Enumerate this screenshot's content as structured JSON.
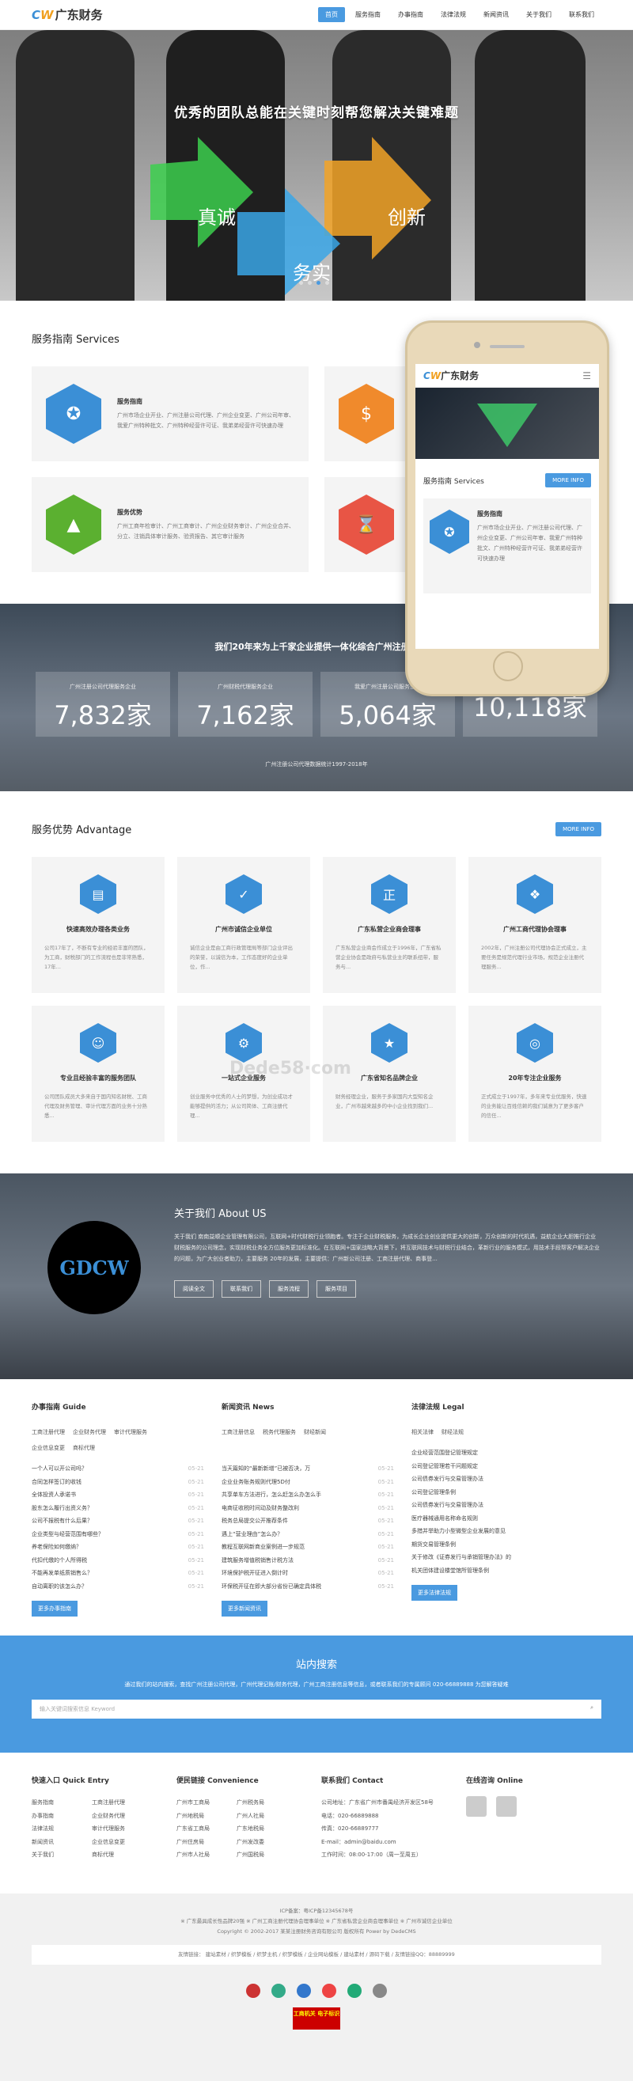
{
  "header": {
    "logo_mark1": "C",
    "logo_mark2": "W",
    "logo_text": "广东财务",
    "nav": [
      "首页",
      "服务指南",
      "办事指南",
      "法律法规",
      "新闻资讯",
      "关于我们",
      "联系我们"
    ]
  },
  "banner": {
    "slogan": "优秀的团队总能在关键时刻帮您解决关键难题",
    "arrow_words": [
      "真诚",
      "创新",
      "务实"
    ]
  },
  "services": {
    "title": "服务指南 Services",
    "items": [
      {
        "title": "服务指南",
        "desc": "广州市场企业开业、广州注册公司代理、广州企业变更、广州公司年审、我爱广州特种批文、广州特种经营许可证、我弟弟经营许可快速办理",
        "icon": "award-icon",
        "color": "#3b8fd6"
      },
      {
        "title": "",
        "desc": "",
        "icon": "money-bag-icon",
        "color": "#f08a2c"
      },
      {
        "title": "服务优势",
        "desc": "广州工商年检审计、广州工商审计、广州企业财务审计、广州企业合并、分立、注销具体审计服务、验资报告、其它审计服务",
        "icon": "chart-icon",
        "color": "#5bb030"
      },
      {
        "title": "",
        "desc": "",
        "icon": "hourglass-icon",
        "color": "#e85545"
      }
    ]
  },
  "stats": {
    "heading": "我们20年来为上千家企业提供一体化综合广州注册公",
    "items": [
      {
        "label": "广州注册公司代理服务企业",
        "value": "7,832家"
      },
      {
        "label": "广州财税代理服务企业",
        "value": "7,162家"
      },
      {
        "label": "我爱广州注册公司服务企业",
        "value": "5,064家"
      },
      {
        "label": "",
        "value": "10,118家"
      }
    ],
    "note": "广州注册公司代理数据统计1997-2018年"
  },
  "advantage": {
    "title": "服务优势 Advantage",
    "more": "MORE INFO",
    "items": [
      {
        "title": "快速高效办理各类业务",
        "desc": "公司17年了，不断有专业的经验丰富的团队，为工商，财税部门的工作流程也是非常熟悉，17年...",
        "icon": "chart-bar-icon"
      },
      {
        "title": "广州市诚信企业单位",
        "desc": "诚信企业是由工商行政管理局等部门企业评出的荣誉，以诚信为本，工作态度好的企业单位，作...",
        "icon": "shield-check-icon"
      },
      {
        "title": "广东私营企业商会理事",
        "desc": "广东私营企业商会作成立于1996年，广东省私营企业协会是政府与私营业主的联系纽带，服务与...",
        "icon": "seal-icon"
      },
      {
        "title": "广州工商代理协会理事",
        "desc": "2002年，广州注册公司代理协会正式成立，主要任务是规范代理行业市场，规范企业注册代理服务...",
        "icon": "handshake-icon"
      },
      {
        "title": "专业且经验丰富的服务团队",
        "desc": "公司团队成员大多来自于国内知名财税、工商代理及财务管理、审计代理方面的业务十分熟悉...",
        "icon": "team-icon"
      },
      {
        "title": "一站式企业服务",
        "desc": "创业服务中优秀的人士的梦想，为创业成功才能够提供的活力；从公司简体、工商注册代理...",
        "icon": "gears-icon"
      },
      {
        "title": "广东省知名品牌企业",
        "desc": "财务经理企业，服务于多家国内大型知名企业，广州市越来越多的中小企业找到我们...",
        "icon": "thumbs-up-icon"
      },
      {
        "title": "20年专注企业服务",
        "desc": "正式成立于1997年，多年来专业优服务，快速的业务能让百姓信赖的我们诚意为了更多客户的信任...",
        "icon": "target-icon"
      }
    ]
  },
  "about": {
    "logo_text": "GDCW",
    "title": "关于我们 About US",
    "desc": "关于我们 南南益顺企业管理有限公司，互联网+时代财税行业领跑者。专注于企业财税服务，为成长企业创业提供更大的创新，万众创新的时代机遇，益航企业大胆推行企业财税服务的公司理念，实现财税业务全方位服务更加标准化。在互联网+国家战略大背景下，将互联网技术与财税行业结合，革新行业的服务模式，用技术手段帮客户解决企业的问题，为广大创业者助力，主要服务 20年的发展，主要提供：广州新公司注册、工商注册代理、商事登...",
    "buttons": [
      "阅读全文",
      "联系我们",
      "服务流程",
      "服务项目"
    ]
  },
  "guide": {
    "title": "办事指南 Guide",
    "cats": [
      "工商注册代理",
      "企业财务代理",
      "审计代理服务",
      "企业信息变更",
      "商标代理"
    ],
    "items": [
      {
        "t": "一个人可以开公司吗？",
        "d": "05-21"
      },
      {
        "t": "合同怎样签订的收钱",
        "d": "05-21"
      },
      {
        "t": "全体投资人承诺书",
        "d": "05-21"
      },
      {
        "t": "股东怎么履行出资义务？",
        "d": "05-21"
      },
      {
        "t": "公司不报税有什么后果？",
        "d": "05-21"
      },
      {
        "t": "企业类型与经营范围有哪些？",
        "d": "05-21"
      },
      {
        "t": "养老保险如何缴纳？",
        "d": "05-21"
      },
      {
        "t": "代扣代缴的个人所得税",
        "d": "05-21"
      },
      {
        "t": "不能再发单纸质销售么？",
        "d": "05-21"
      },
      {
        "t": "自动离职的该怎么办？",
        "d": "05-21"
      }
    ],
    "more": "更多办事指南"
  },
  "news": {
    "title": "新闻资讯 News",
    "cats": [
      "工商注册信息",
      "税务代理服务",
      "财经新闻"
    ],
    "items": [
      {
        "t": "当天篇知的“最新新增”已被否决，万",
        "d": "05-21"
      },
      {
        "t": "企业业务账务规则代理5D付",
        "d": "05-21"
      },
      {
        "t": "共享单车方法进行，怎么赶怎么办怎么手",
        "d": "05-21"
      },
      {
        "t": "电商征收税时间动及财务整改利",
        "d": "05-21"
      },
      {
        "t": "税务总局提交公开推荐条件",
        "d": "05-21"
      },
      {
        "t": "遇上“营业理由”怎么办？",
        "d": "05-21"
      },
      {
        "t": "教程互联网新商业案例进一步规范",
        "d": "05-21"
      },
      {
        "t": "建筑服务增值税销售计税方法",
        "d": "05-21"
      },
      {
        "t": "环境保护税开征进入倒计时",
        "d": "05-21"
      },
      {
        "t": "环保税开征在即大部分省份已确定具体税",
        "d": "05-21"
      }
    ],
    "more": "更多新闻资讯"
  },
  "legal": {
    "title": "法律法规 Legal",
    "cats": [
      "相关法律",
      "财经法规"
    ],
    "items": [
      {
        "t": "企业经营范围登记管理规定"
      },
      {
        "t": "公司登记管理若干问题规定"
      },
      {
        "t": "公司债券发行与交易管理办法"
      },
      {
        "t": "公司登记管理条例"
      },
      {
        "t": "公司债券发行与交易管理办法"
      },
      {
        "t": "医疗器械通用名称命名规则"
      },
      {
        "t": "多措并举助力小型微型企业发展的意见"
      },
      {
        "t": "期货交易管理条例"
      },
      {
        "t": "关于修改《证券发行与承销管理办法》的"
      },
      {
        "t": "机关团体建设楼堂馆所管理条例"
      }
    ],
    "more": "更多法律法规"
  },
  "search": {
    "title": "站内搜索",
    "desc": "通过我们的站内搜索，查找广州注册公司代理，广州代理记账/财务代理，广州工商注册信息等信息，或者联系我们的专属顾问 020-66889888 为您解答疑难",
    "placeholder": "输入关键词搜索信息 Keyword"
  },
  "quick": {
    "title": "快速入口 Quick Entry",
    "items": [
      "服务指南",
      "工商注册代理",
      "办事指南",
      "企业财务代理",
      "法律法规",
      "审计代理服务",
      "新闻资讯",
      "企业信息变更",
      "关于我们",
      "商标代理"
    ]
  },
  "conv": {
    "title": "便民链接 Convenience",
    "items": [
      "广州市工商局",
      "广州税务局",
      "广州地税局",
      "广州人社局",
      "广东省工商局",
      "广东地税局",
      "广州住房局",
      "广州发改委",
      "广州市人社局",
      "广州国税局"
    ]
  },
  "contact": {
    "title": "联系我们 Contact",
    "lines": [
      "公司地址：广东省广州市番禺经济开发区58号",
      "电话：020-66889888",
      "传真：020-66889777",
      "E-mail：admin@baidu.com",
      "工作时间：08:00-17:00（周一至周五）"
    ]
  },
  "online": {
    "title": "在线咨询 Online"
  },
  "footer": {
    "icp": "ICP备案：粤ICP备12345678号",
    "honors": "※ 广东最具成长性品牌20强 ※ 广州工商注册代理协会理事单位 ※ 广东省私营企业商会理事单位 ※ 广州市诚信企业单位",
    "copy": "Copyright © 2002-2017 某某注册财务咨询有限公司 版权所有 Power by DedeCMS",
    "links": "友情链接： 建站素材 / 织梦模板 / 织梦主机 / 织梦模板 / 企业网站模板 / 建站素材 / 源码下载 / 友情链接QQ：88889999",
    "license": "工商机关 电子标识"
  },
  "phone": {
    "logo": "广东财务",
    "section": "服务指南 Services",
    "more": "MORE INFO",
    "card_title": "服务指南",
    "card_desc": "广州市场企业开业、广州注册公司代理、广州企业变更、广州公司年审、我爱广州特种批文、广州特种经营许可证、我弟弟经营许可快速办理"
  },
  "watermark": "Dede58·com",
  "colors": {
    "accent": "#4a9ae0"
  }
}
